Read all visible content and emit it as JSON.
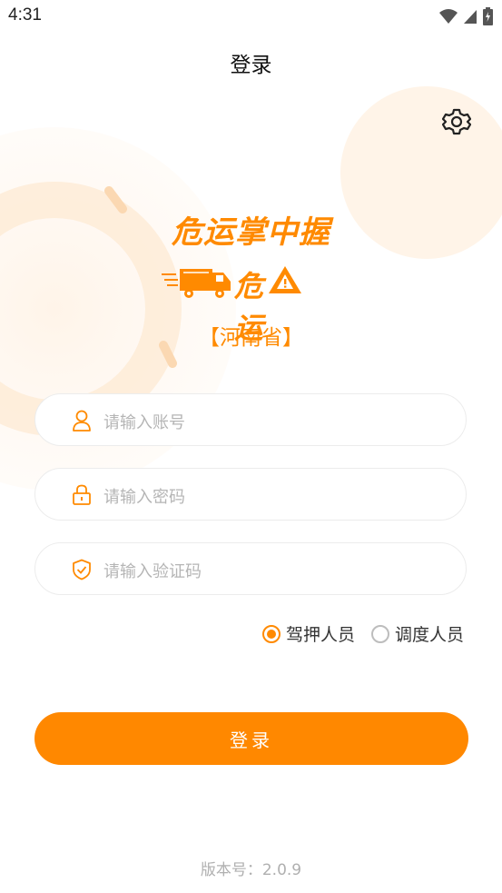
{
  "status_bar": {
    "time": "4:31"
  },
  "header": {
    "title": "登录"
  },
  "logo": {
    "app_name": "危运掌中握",
    "brand": "危运"
  },
  "province": "【河南省】",
  "form": {
    "account_placeholder": "请输入账号",
    "password_placeholder": "请输入密码",
    "captcha_placeholder": "请输入验证码"
  },
  "roles": [
    {
      "label": "驾押人员",
      "selected": true
    },
    {
      "label": "调度人员",
      "selected": false
    }
  ],
  "login_button": "登录",
  "version_text": "版本号：2.0.9",
  "colors": {
    "accent": "#ff8800",
    "placeholder": "#b5b5b5"
  }
}
